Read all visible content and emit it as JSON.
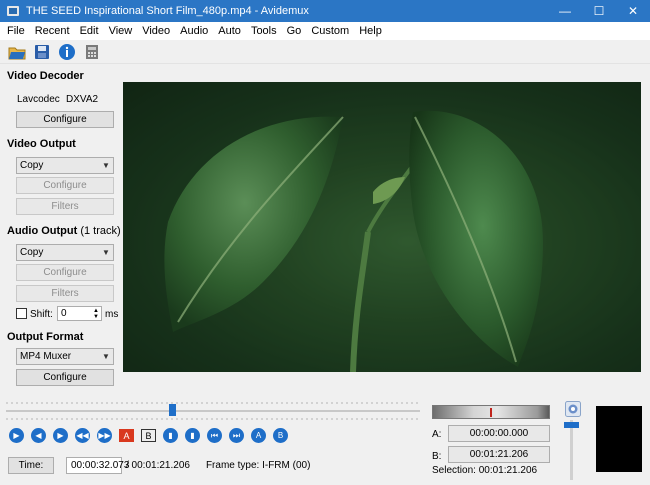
{
  "window": {
    "title": "THE SEED  Inspirational Short Film_480p.mp4 - Avidemux",
    "minimize": "—",
    "maximize": "☐",
    "close": "✕"
  },
  "menu": [
    "File",
    "Recent",
    "Edit",
    "View",
    "Video",
    "Audio",
    "Auto",
    "Tools",
    "Go",
    "Custom",
    "Help"
  ],
  "toolbar": [
    "open-folder-icon",
    "save-icon",
    "info-icon",
    "calculator-icon"
  ],
  "video_decoder": {
    "title": "Video Decoder",
    "codec": "Lavcodec",
    "accel": "DXVA2",
    "configure": "Configure"
  },
  "video_output": {
    "title": "Video Output",
    "value": "Copy",
    "configure": "Configure",
    "filters": "Filters"
  },
  "audio_output": {
    "title": "Audio Output",
    "tracks": "(1 track)",
    "value": "Copy",
    "configure": "Configure",
    "filters": "Filters",
    "shift_label": "Shift:",
    "shift_value": "0",
    "shift_unit": "ms"
  },
  "output_format": {
    "title": "Output Format",
    "value": "MP4 Muxer",
    "configure": "Configure"
  },
  "playback": {
    "position": 0.4,
    "time_button": "Time:",
    "current_time": "00:00:32.073",
    "total_time": "/ 00:01:21.206",
    "frame_type": "Frame type:  I-FRM (00)"
  },
  "controls": [
    "play-icon",
    "previous-frame-icon",
    "next-frame-icon",
    "previous-keyframe-icon",
    "next-keyframe-icon",
    "set-marker-a-icon",
    "set-marker-b-icon",
    "previous-cut-icon",
    "next-cut-icon",
    "first-frame-icon",
    "last-frame-icon",
    "go-to-marker-a-icon",
    "go-to-marker-b-icon"
  ],
  "markers": {
    "a_label": "A:",
    "a_value": "00:00:00.000",
    "b_label": "B:",
    "b_value": "00:01:21.206",
    "selection": "Selection: 00:01:21.206"
  },
  "colors": {
    "titlebar": "#2b76c5",
    "accent": "#1e6ec8"
  }
}
